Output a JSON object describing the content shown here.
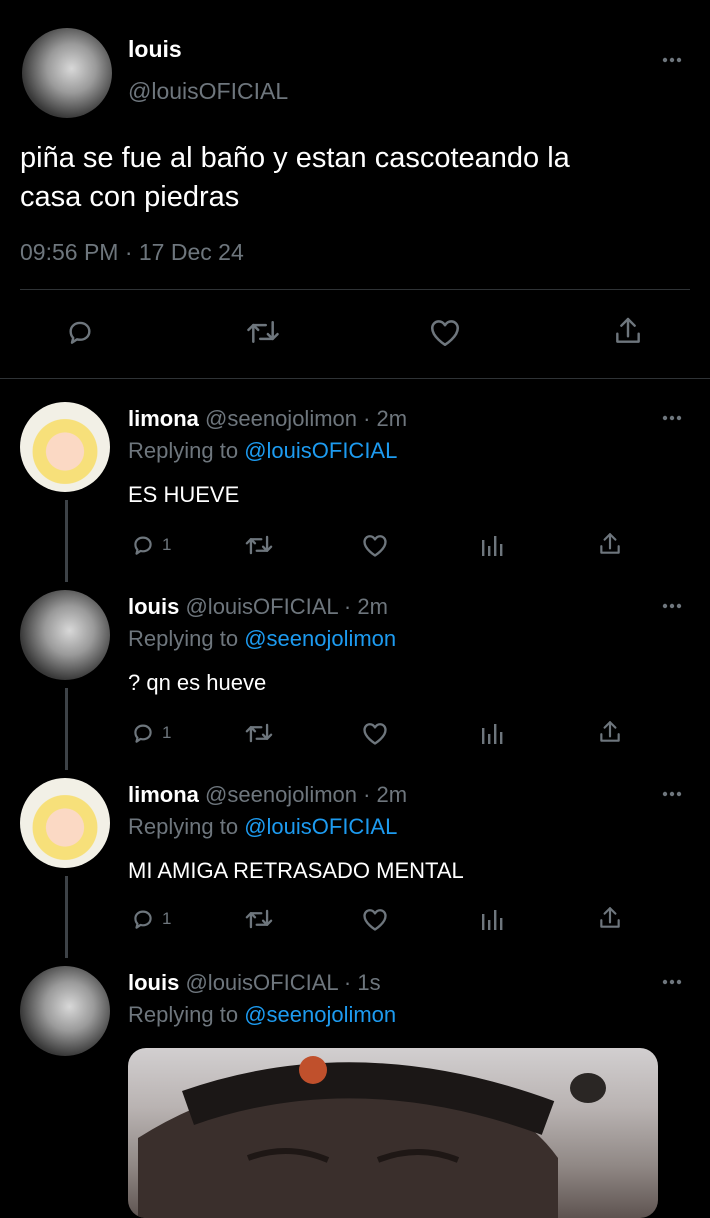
{
  "main_tweet": {
    "name": "louis",
    "handle": "@louisOFICIAL",
    "text_line1": "piña se fue al baño y estan cascoteando la",
    "text_line2": "casa con piedras",
    "timestamp": "09:56 PM · 17 Dec 24"
  },
  "replies": [
    {
      "name": "limona",
      "meta": "@seenojolimon · 2m",
      "replying_prefix": "Replying to ",
      "replying_to": "@louisOFICIAL",
      "text": "ES HUEVE",
      "reply_count": "1"
    },
    {
      "name": "louis",
      "meta": "@louisOFICIAL · 2m",
      "replying_prefix": "Replying to ",
      "replying_to": "@seenojolimon",
      "text": "? qn es hueve",
      "reply_count": "1"
    },
    {
      "name": "limona",
      "meta": "@seenojolimon · 2m",
      "replying_prefix": "Replying to ",
      "replying_to": "@louisOFICIAL",
      "text": "MI AMIGA RETRASADO MENTAL",
      "reply_count": "1"
    },
    {
      "name": "louis",
      "meta": "@louisOFICIAL · 1s",
      "replying_prefix": "Replying to ",
      "replying_to": "@seenojolimon"
    }
  ],
  "colors": {
    "background": "#000000",
    "text": "#ffffff",
    "muted": "#6e767d",
    "link": "#1d9bf0",
    "divider": "#2f3336"
  },
  "icons": [
    "more-icon",
    "reply-icon",
    "retweet-icon",
    "like-icon",
    "share-icon",
    "analytics-icon"
  ]
}
